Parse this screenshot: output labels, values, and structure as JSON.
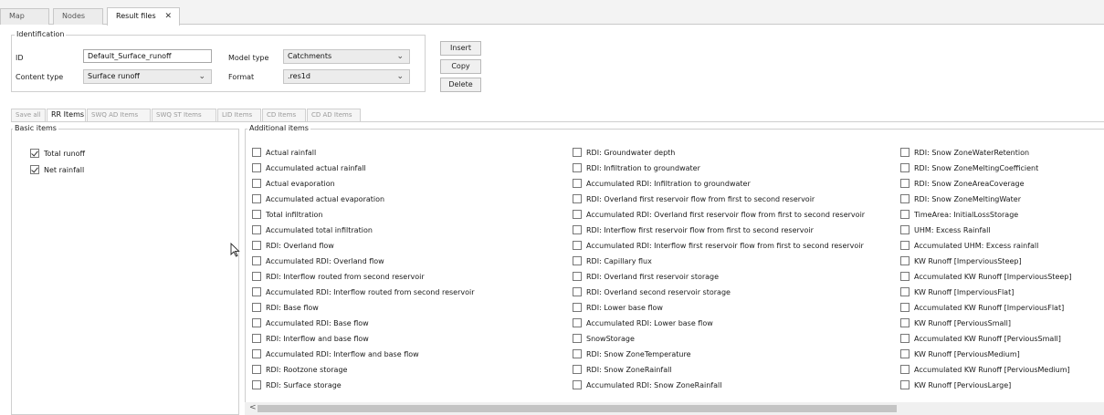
{
  "tabs": [
    "Map",
    "Nodes",
    "Result files"
  ],
  "tab_close": "✕",
  "identification": {
    "title": "Identification",
    "id_label": "ID",
    "id_value": "Default_Surface_runoff",
    "model_type_label": "Model type",
    "model_type_value": "Catchments",
    "content_type_label": "Content type",
    "content_type_value": "Surface runoff",
    "format_label": "Format",
    "format_value": ".res1d"
  },
  "buttons": {
    "insert": "Insert",
    "copy": "Copy",
    "delete": "Delete"
  },
  "sub_tabs": [
    "Save all",
    "RR Items",
    "SWQ AD Items",
    "SWQ ST Items",
    "LID Items",
    "CD Items",
    "CD AD Items"
  ],
  "basic_items": {
    "title": "Basic items",
    "items": [
      {
        "label": "Total runoff",
        "checked": true
      },
      {
        "label": "Net rainfall",
        "checked": true
      }
    ]
  },
  "additional_items": {
    "title": "Additional items",
    "columns": [
      [
        "Actual rainfall",
        "Accumulated actual rainfall",
        "Actual evaporation",
        "Accumulated actual evaporation",
        "Total infiltration",
        "Accumulated total infiltration",
        "RDI: Overland flow",
        "Accumulated RDI: Overland flow",
        "RDI: Interflow routed from second reservoir",
        "Accumulated RDI: Interflow routed from second reservoir",
        "RDI: Base flow",
        "Accumulated RDI: Base flow",
        "RDI: Interflow and base flow",
        "Accumulated RDI: Interflow and base flow",
        "RDI: Rootzone storage",
        "RDI: Surface storage"
      ],
      [
        "RDI: Groundwater depth",
        "RDI: Infiltration to groundwater",
        "Accumulated RDI: Infiltration to groundwater",
        "RDI: Overland first reservoir flow from first to second reservoir",
        "Accumulated RDI: Overland first reservoir flow from first to second reservoir",
        "RDI: Interflow first reservoir flow from first to second reservoir",
        "Accumulated RDI: Interflow first reservoir flow from first to second reservoir",
        "RDI: Capillary flux",
        "RDI: Overland first reservoir storage",
        "RDI: Overland second reservoir storage",
        "RDI: Lower base flow",
        "Accumulated RDI: Lower base flow",
        "SnowStorage",
        "RDI: Snow ZoneTemperature",
        "RDI: Snow ZoneRainfall",
        "Accumulated RDI: Snow ZoneRainfall"
      ],
      [
        "RDI: Snow ZoneWaterRetention",
        "RDI: Snow ZoneMeltingCoefficient",
        "RDI: Snow ZoneAreaCoverage",
        "RDI: Snow ZoneMeltingWater",
        "TimeArea: InitialLossStorage",
        "UHM: Excess Rainfall",
        "Accumulated UHM: Excess rainfall",
        "KW Runoff [ImperviousSteep]",
        "Accumulated KW Runoff [ImperviousSteep]",
        "KW Runoff [ImperviousFlat]",
        "Accumulated KW Runoff [ImperviousFlat]",
        "KW Runoff [PerviousSmall]",
        "Accumulated KW Runoff [PerviousSmall]",
        "KW Runoff [PerviousMedium]",
        "Accumulated KW Runoff [PerviousMedium]",
        "KW Runoff [PerviousLarge]"
      ]
    ]
  },
  "scrollbar": {
    "left_arrow": "<"
  }
}
